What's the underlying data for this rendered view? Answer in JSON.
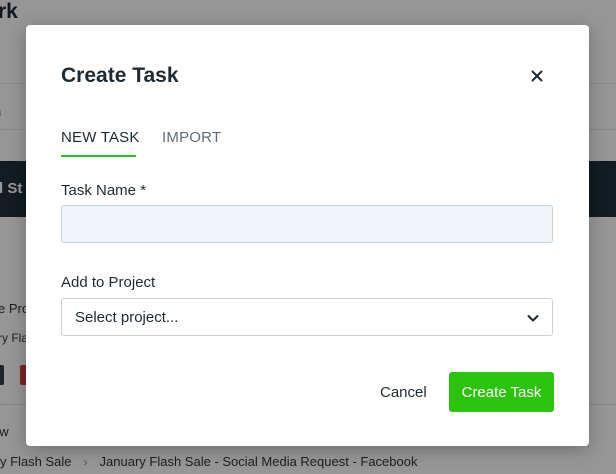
{
  "background": {
    "page_title": "rk",
    "search_fragment": "h",
    "band_text": "d St",
    "row_text_1": "e Pro",
    "row_text_2": "ry Fla",
    "view_text": "ew",
    "breadcrumb": [
      "y Flash Sale",
      "January Flash Sale - Social Media Request - Facebook"
    ],
    "breadcrumb_separator": "›"
  },
  "modal": {
    "title": "Create Task",
    "close_icon": "close-icon",
    "tabs": [
      {
        "label": "NEW TASK",
        "active": true
      },
      {
        "label": "IMPORT",
        "active": false
      }
    ],
    "task_name": {
      "label": "Task Name *",
      "value": "",
      "placeholder": ""
    },
    "project": {
      "label": "Add to Project",
      "selected": "Select project...",
      "icon": "chevron-down-icon"
    },
    "buttons": {
      "cancel": "Cancel",
      "create": "Create Task"
    }
  },
  "colors": {
    "accent": "#2bc30d",
    "tab_underline": "#25c21a",
    "text_dark": "#1e2a33",
    "tab_inactive": "#5e6e78",
    "overlay": "rgba(0,0,0,0.40)"
  }
}
